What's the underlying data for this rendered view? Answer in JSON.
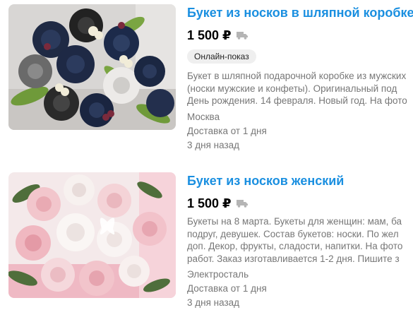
{
  "listings": [
    {
      "title": "Букет из носков в шляпной коробке",
      "price": "1 500 ₽",
      "badge": "Онлайн-показ",
      "description": [
        "Букет в шляпной подарочной коробке из мужских",
        "(носки мужские и конфеты). Оригинальный под",
        "День рождения. 14 февраля. Новый год. На фото"
      ],
      "city": "Москва",
      "delivery": "Доставка от 1 дня",
      "posted": "3 дня назад",
      "photo_icon": "sock-bouquet-dark-photo"
    },
    {
      "title": "Букет из носков женский",
      "price": "1 500 ₽",
      "description": [
        "Букеты на 8 марта. Букеты для женщин: мам, ба",
        "подруг, девушек. Состав букетов: носки. По жел",
        "доп. Декор, фрукты, сладости, напитки. На фото",
        "работ. Заказ изготавливается 1-2 дня. Пишите з"
      ],
      "city": "Электросталь",
      "delivery": "Доставка от 1 дня",
      "posted": "3 дня назад",
      "photo_icon": "sock-bouquet-pink-photo"
    }
  ],
  "colors": {
    "title": "#1a8fe0",
    "meta_text": "#777777",
    "badge_bg": "#efefef",
    "delivery_icon": "#b5b5b5"
  },
  "icons": {
    "delivery": "truck-icon"
  }
}
